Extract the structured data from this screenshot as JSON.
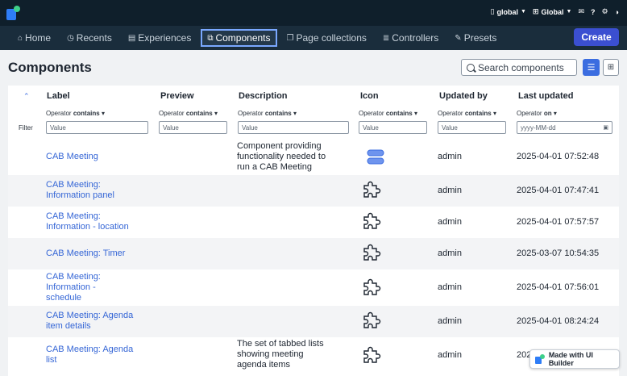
{
  "topbar": {
    "scope_label": "global",
    "app_label": "Global"
  },
  "nav": {
    "tabs": [
      {
        "label": "Home",
        "icon": "home-icon"
      },
      {
        "label": "Recents",
        "icon": "clock-icon"
      },
      {
        "label": "Experiences",
        "icon": "window-icon"
      },
      {
        "label": "Components",
        "icon": "components-icon"
      },
      {
        "label": "Page collections",
        "icon": "pages-icon"
      },
      {
        "label": "Controllers",
        "icon": "database-icon"
      },
      {
        "label": "Presets",
        "icon": "brush-icon"
      }
    ],
    "create_label": "Create"
  },
  "page": {
    "title": "Components",
    "search_placeholder": "Search components"
  },
  "table": {
    "columns": [
      "Label",
      "Preview",
      "Description",
      "Icon",
      "Updated by",
      "Last updated"
    ],
    "filter_label": "Filter",
    "operator_prefix": "Operator",
    "operators": [
      "contains",
      "contains",
      "contains",
      "contains",
      "contains",
      "on"
    ],
    "filter_placeholders": [
      "Value",
      "Value",
      "Value",
      "Value",
      "Value",
      "yyyy-MM-dd"
    ],
    "rows": [
      {
        "label": "CAB Meeting",
        "description": "Component providing functionality needed to run a CAB Meeting",
        "icon": "stacked-blocks-icon",
        "updated_by": "admin",
        "last_updated": "2025-04-01 07:52:48"
      },
      {
        "label": "CAB Meeting: Information panel",
        "description": "",
        "icon": "puzzle-icon",
        "updated_by": "admin",
        "last_updated": "2025-04-01 07:47:41"
      },
      {
        "label": "CAB Meeting: Information - location",
        "description": "",
        "icon": "puzzle-icon",
        "updated_by": "admin",
        "last_updated": "2025-04-01 07:57:57"
      },
      {
        "label": "CAB Meeting: Timer",
        "description": "",
        "icon": "puzzle-icon",
        "updated_by": "admin",
        "last_updated": "2025-03-07 10:54:35"
      },
      {
        "label": "CAB Meeting: Information - schedule",
        "description": "",
        "icon": "puzzle-icon",
        "updated_by": "admin",
        "last_updated": "2025-04-01 07:56:01"
      },
      {
        "label": "CAB Meeting: Agenda item details",
        "description": "",
        "icon": "puzzle-icon",
        "updated_by": "admin",
        "last_updated": "2025-04-01 08:24:24"
      },
      {
        "label": "CAB Meeting: Agenda list",
        "description": "The set of tabbed lists showing meeting agenda items",
        "icon": "puzzle-icon",
        "updated_by": "admin",
        "last_updated": "202"
      }
    ]
  },
  "badge": {
    "label": "Made with UI Builder"
  }
}
